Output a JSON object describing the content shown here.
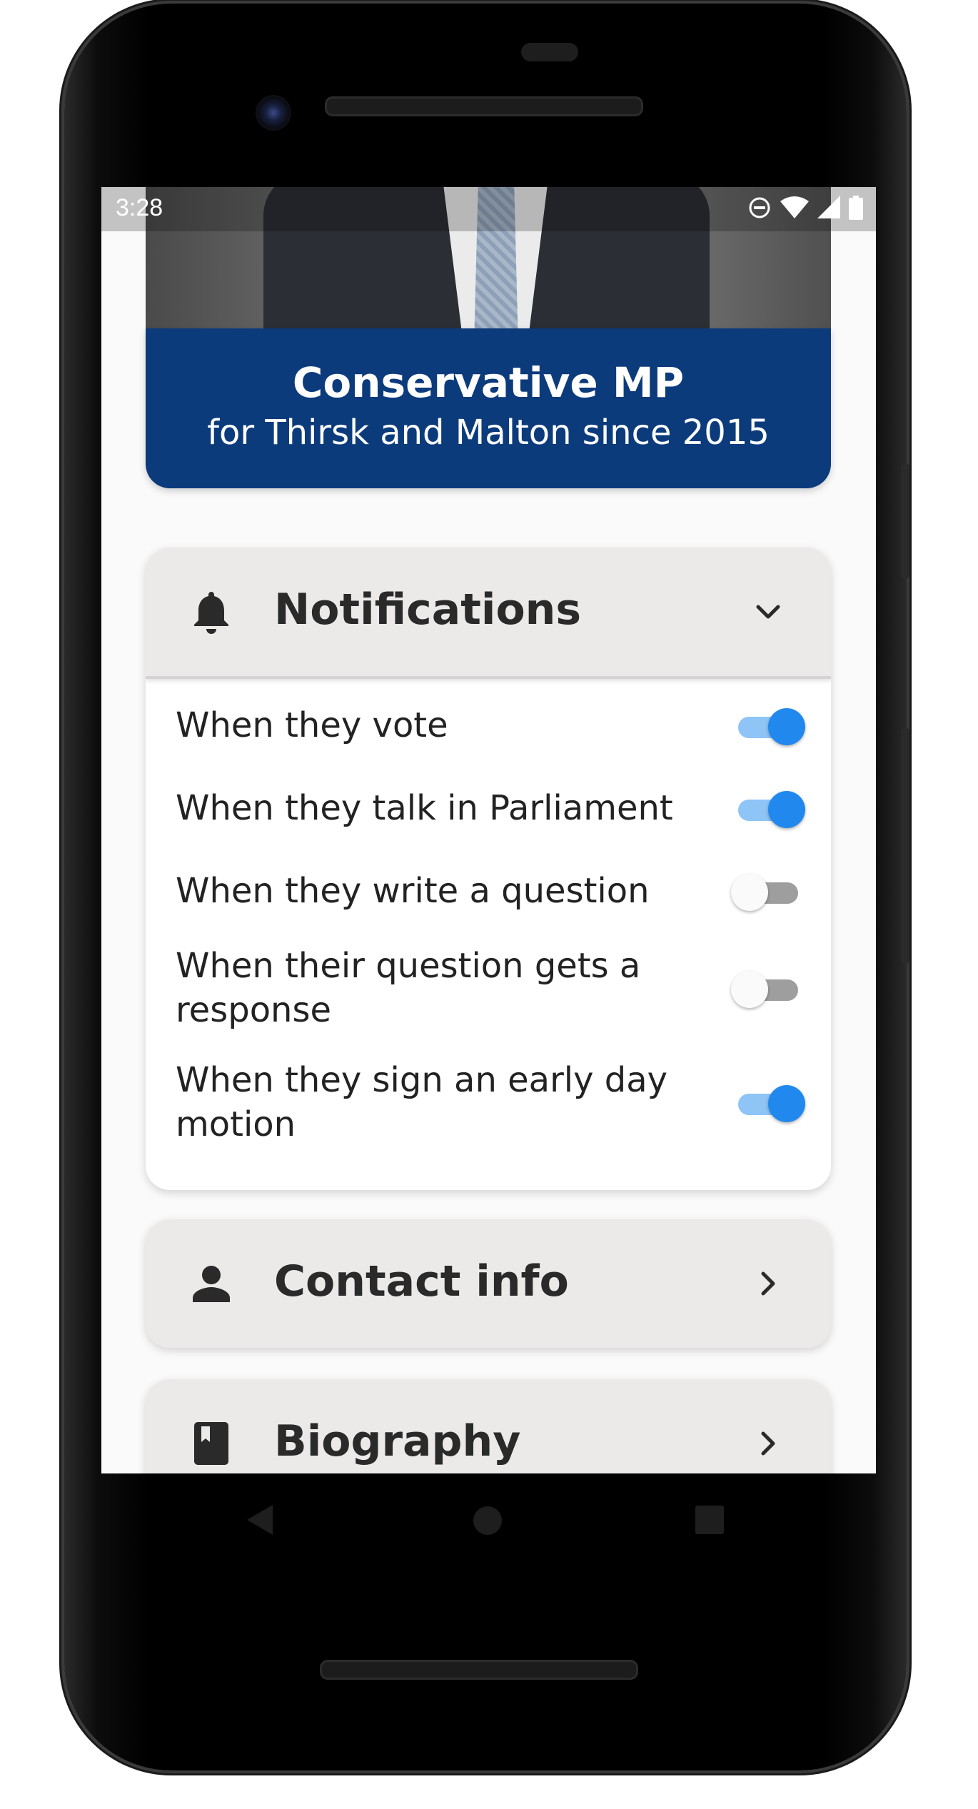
{
  "status_bar": {
    "time": "3:28",
    "icons": [
      "do-not-disturb-icon",
      "wifi-icon",
      "signal-icon",
      "battery-icon"
    ]
  },
  "banner": {
    "title": "Conservative MP",
    "subtitle": "for Thirsk and Malton since 2015"
  },
  "notifications": {
    "title": "Notifications",
    "icon": "bell-icon",
    "chevron": "chevron-down-icon",
    "items": [
      {
        "label": "When they vote",
        "enabled": true
      },
      {
        "label": "When they talk in Parliament",
        "enabled": true
      },
      {
        "label": "When they write a question",
        "enabled": false
      },
      {
        "label": "When their question gets a response",
        "enabled": false
      },
      {
        "label": "When they sign an early day motion",
        "enabled": true
      }
    ]
  },
  "contact_info": {
    "title": "Contact info",
    "icon": "person-icon",
    "chevron": "chevron-right-icon"
  },
  "biography": {
    "title": "Biography",
    "icon": "book-icon",
    "chevron": "chevron-right-icon"
  },
  "nav_bar": {
    "buttons": [
      "back-icon",
      "home-icon",
      "recents-icon"
    ]
  },
  "colors": {
    "banner_bg": "#0c3b7c",
    "toggle_on": "#2189ee",
    "toggle_on_track": "#8ec4f6",
    "card_header_bg": "#ebeae9"
  }
}
